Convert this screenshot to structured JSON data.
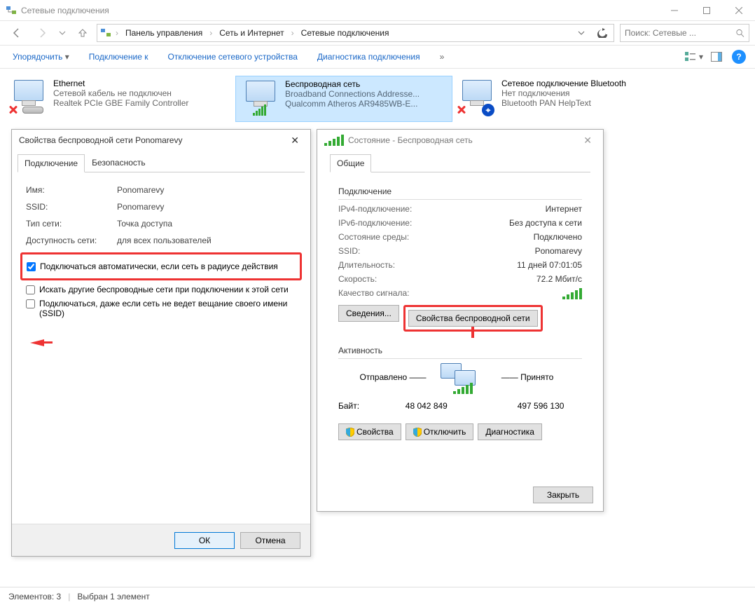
{
  "window": {
    "title": "Сетевые подключения"
  },
  "breadcrumb": {
    "items": [
      "Панель управления",
      "Сеть и Интернет",
      "Сетевые подключения"
    ]
  },
  "search": {
    "placeholder": "Поиск: Сетевые ..."
  },
  "toolbar": {
    "organize": "Упорядочить",
    "connectTo": "Подключение к",
    "disableDevice": "Отключение сетевого устройства",
    "diagnose": "Диагностика подключения"
  },
  "connections": [
    {
      "name": "Ethernet",
      "status": "Сетевой кабель не подключен",
      "device": "Realtek PCIe GBE Family Controller"
    },
    {
      "name": "Беспроводная сеть",
      "status": "Broadband Connections Addresse...",
      "device": "Qualcomm Atheros AR9485WB-E..."
    },
    {
      "name": "Сетевое подключение Bluetooth",
      "status": "Нет подключения",
      "device": "Bluetooth PAN HelpText"
    }
  ],
  "dlg1": {
    "title": "Свойства беспроводной сети Ponomarevy",
    "tabs": {
      "t1": "Подключение",
      "t2": "Безопасность"
    },
    "labels": {
      "name": "Имя:",
      "ssid": "SSID:",
      "type": "Тип сети:",
      "avail": "Доступность сети:"
    },
    "values": {
      "name": "Ponomarevy",
      "ssid": "Ponomarevy",
      "type": "Точка доступа",
      "avail": "для всех пользователей"
    },
    "checks": {
      "c1": "Подключаться автоматически, если сеть в радиусе действия",
      "c2": "Искать другие беспроводные сети при подключении к этой сети",
      "c3": "Подключаться, даже если сеть не ведет вещание своего имени (SSID)"
    },
    "ok": "ОК",
    "cancel": "Отмена"
  },
  "dlg2": {
    "title": "Состояние - Беспроводная сеть",
    "tab": "Общие",
    "groupConn": "Подключение",
    "rows": {
      "ipv4": {
        "k": "IPv4-подключение:",
        "v": "Интернет"
      },
      "ipv6": {
        "k": "IPv6-подключение:",
        "v": "Без доступа к сети"
      },
      "media": {
        "k": "Состояние среды:",
        "v": "Подключено"
      },
      "ssid": {
        "k": "SSID:",
        "v": "Ponomarevy"
      },
      "dur": {
        "k": "Длительность:",
        "v": "11 дней 07:01:05"
      },
      "speed": {
        "k": "Скорость:",
        "v": "72.2 Мбит/с"
      },
      "signal": {
        "k": "Качество сигнала:"
      }
    },
    "details": "Сведения...",
    "wlanprops": "Свойства беспроводной сети",
    "groupAct": "Активность",
    "sent": "Отправлено",
    "recv": "Принято",
    "bytes": "Байт:",
    "sentv": "48 042 849",
    "recvv": "497 596 130",
    "props": "Свойства",
    "disable": "Отключить",
    "diag": "Диагностика",
    "close": "Закрыть"
  },
  "status": {
    "elements": "Элементов: 3",
    "selected": "Выбран 1 элемент"
  }
}
